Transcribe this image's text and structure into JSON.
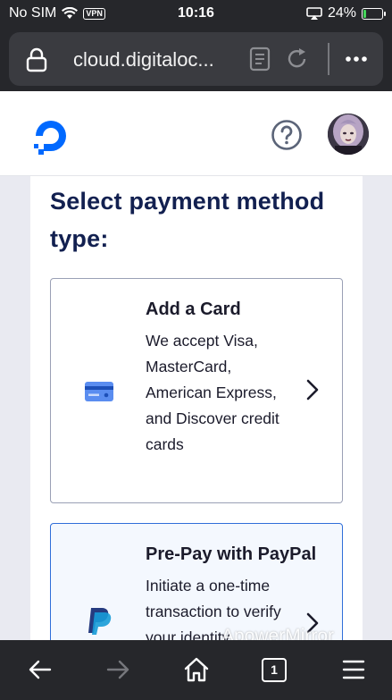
{
  "status_bar": {
    "carrier": "No SIM",
    "vpn": "VPN",
    "time": "10:16",
    "battery": "24%",
    "battery_level": 0.24
  },
  "browser": {
    "url": "cloud.digitaloc...",
    "tab_count": "1"
  },
  "page": {
    "title": "Select payment method type:",
    "methods": [
      {
        "title": "Add a Card",
        "description": "We accept Visa, MasterCard, American Express, and Discover credit cards",
        "icon": "credit-card-icon"
      },
      {
        "title": "Pre-Pay with PayPal",
        "description": "Initiate a one-time transaction to verify your identity",
        "icon": "paypal-icon"
      }
    ]
  },
  "watermark": "ApowerMirror",
  "colors": {
    "brand_blue": "#0069ff",
    "heading_navy": "#122050",
    "selected_border": "#2f6ed9"
  }
}
